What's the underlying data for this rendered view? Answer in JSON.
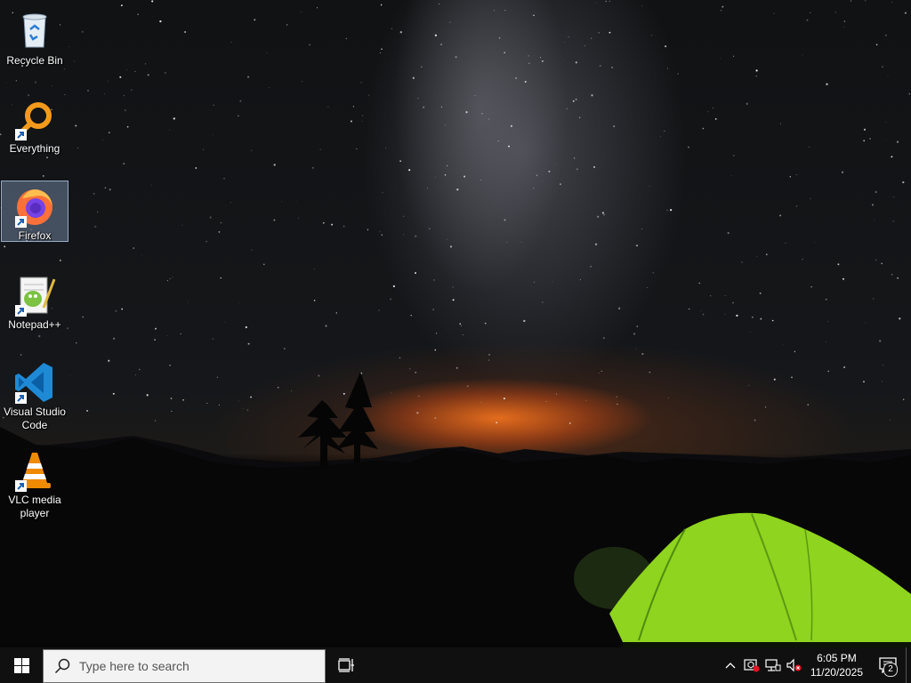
{
  "desktop": {
    "icons": [
      {
        "label": "Recycle Bin",
        "icon": "recycle-bin-icon",
        "shortcut": false,
        "selected": false
      },
      {
        "label": "Everything",
        "icon": "everything-icon",
        "shortcut": true,
        "selected": false
      },
      {
        "label": "Firefox",
        "icon": "firefox-icon",
        "shortcut": true,
        "selected": true
      },
      {
        "label": "Notepad++",
        "icon": "notepadpp-icon",
        "shortcut": true,
        "selected": false
      },
      {
        "label": "Visual Studio Code",
        "icon": "vscode-icon",
        "shortcut": true,
        "selected": false
      },
      {
        "label": "VLC media player",
        "icon": "vlc-icon",
        "shortcut": true,
        "selected": false
      }
    ]
  },
  "taskbar": {
    "search_placeholder": "Type here to search",
    "clock_time": "6:05 PM",
    "clock_date": "11/20/2025",
    "notification_count": "2"
  },
  "colors": {
    "taskbar_bg": "#101010",
    "selection_bg": "#a0bee6",
    "tent_green": "#8fe020",
    "vscode_blue": "#1e8ad6",
    "vlc_orange": "#f08a00"
  }
}
